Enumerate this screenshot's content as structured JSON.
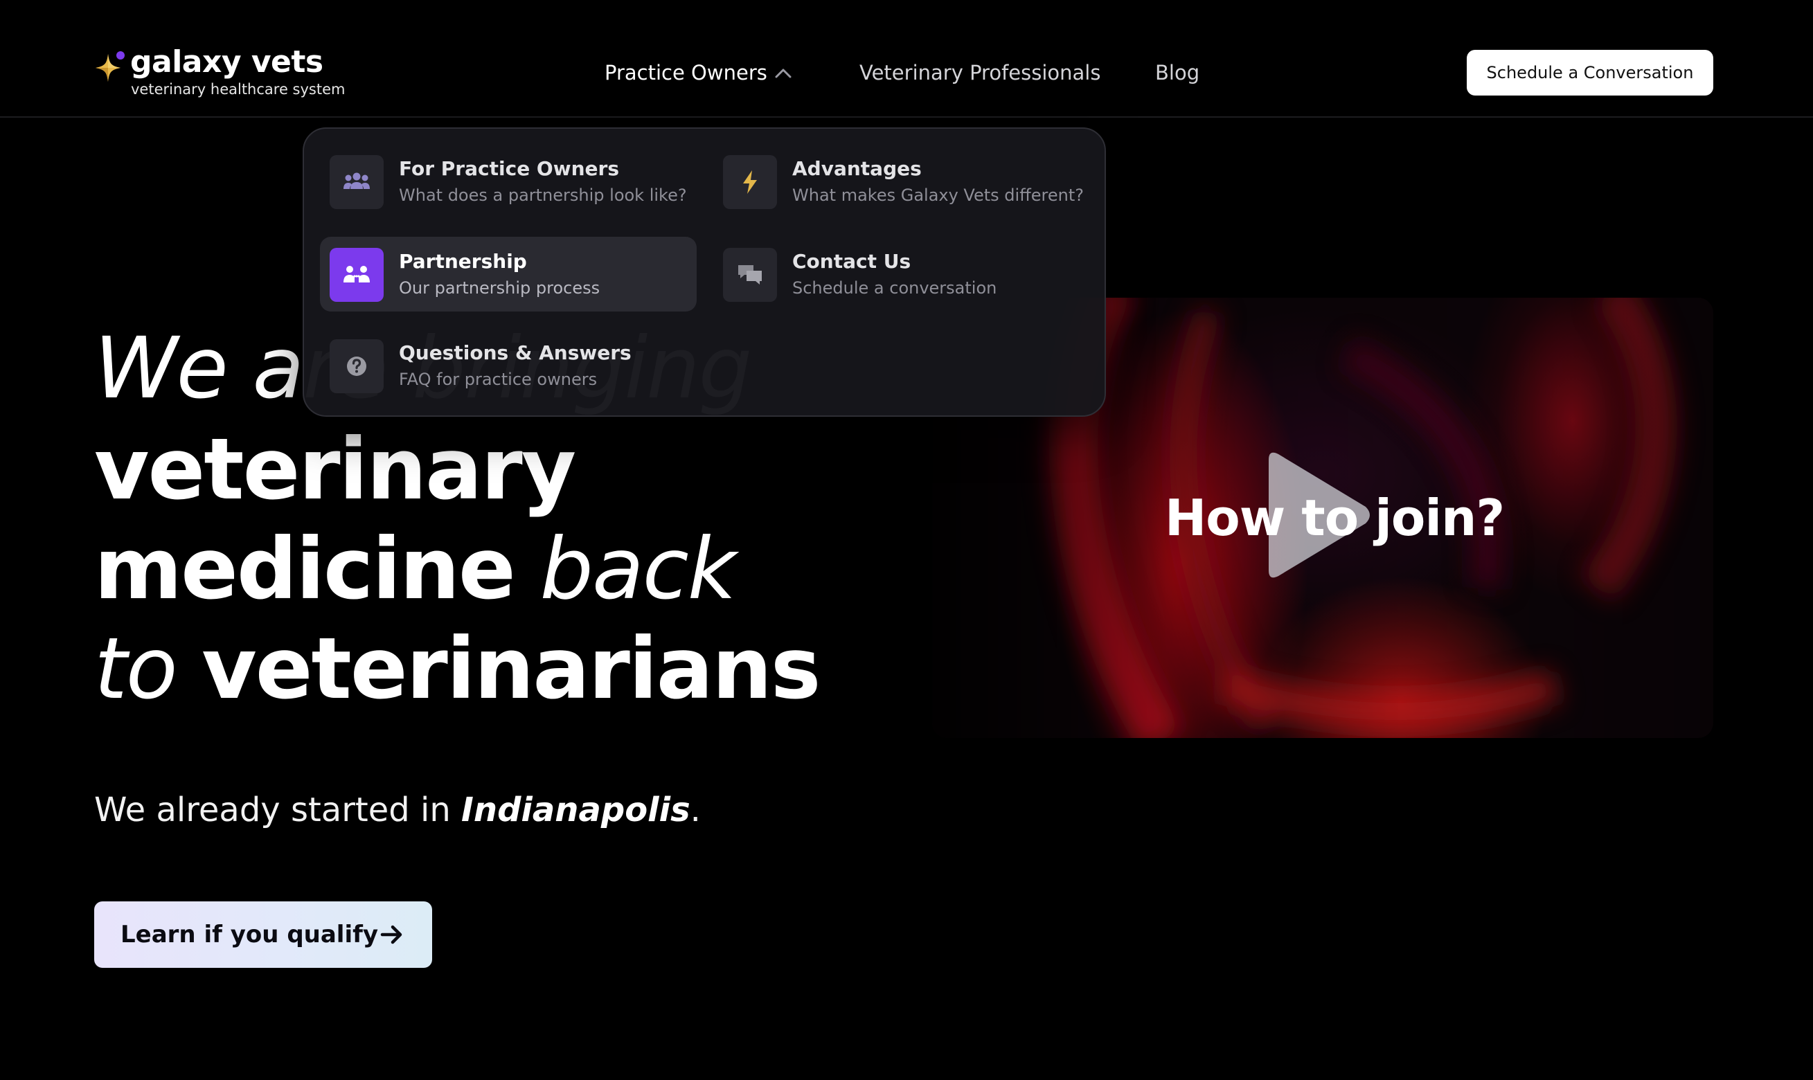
{
  "brand": {
    "name": "galaxy vets",
    "tagline": "veterinary healthcare system",
    "colors": {
      "star_gold": "#e9b949",
      "star_purple": "#7c3aed",
      "accent": "#7c3aed"
    }
  },
  "nav": {
    "items": [
      {
        "label": "Practice Owners",
        "active": true,
        "icon": "chevron-up-icon"
      },
      {
        "label": "Veterinary Professionals"
      },
      {
        "label": "Blog"
      }
    ],
    "cta_label": "Schedule a Conversation"
  },
  "dropdown": {
    "items": [
      {
        "title": "For Practice Owners",
        "desc": "What does a partnership look like?",
        "icon": "people-group-icon"
      },
      {
        "title": "Advantages",
        "desc": "What makes Galaxy Vets different?",
        "icon": "lightning-icon"
      },
      {
        "title": "Partnership",
        "desc": "Our partnership process",
        "icon": "partnership-icon",
        "selected": true
      },
      {
        "title": "Contact Us",
        "desc": "Schedule a conversation",
        "icon": "chat-bubbles-icon"
      },
      {
        "title": "Questions & Answers",
        "desc": "FAQ for practice owners",
        "icon": "question-icon"
      }
    ]
  },
  "hero": {
    "line1_italic": "We are bringing",
    "line2_bold": "veterinary",
    "line3_bold": "medicine",
    "line3_italic": "back",
    "line4_italic": "to",
    "line4_bold": "veterinarians",
    "sub_prefix": "We already started in",
    "sub_city": "Indianapolis",
    "sub_suffix": ".",
    "cta_label": "Learn if you qualify"
  },
  "video": {
    "title": "How to join?",
    "icon": "play-icon"
  }
}
